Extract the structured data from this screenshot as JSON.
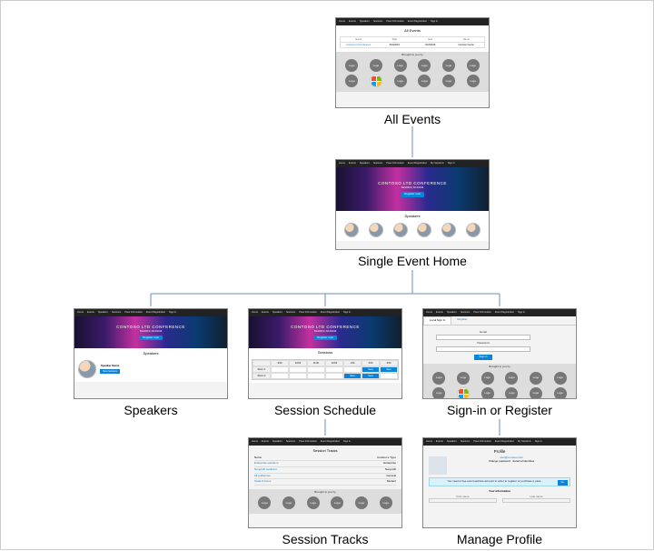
{
  "nav_items": [
    "Home",
    "Events",
    "Speakers",
    "Sessions",
    "Pass Information",
    "Event Registration",
    "My Sessions",
    "Sign In"
  ],
  "conference": {
    "title": "CONTOSO LTD CONFERENCE",
    "dateline": "5/24/2019 | 6/13/2019",
    "cta": "Register now"
  },
  "sections": {
    "speakers_heading": "Speakers",
    "sessions_heading": "Sessions",
    "all_events_heading": "All Events",
    "session_tracks_heading": "Session Tracks",
    "profile_heading": "Profile",
    "sponsors_heading": "Brought to you by"
  },
  "sponsor_label": "Logo",
  "signin": {
    "tab_local": "Local Sign In",
    "tab_register": "Register",
    "email_label": "Email",
    "password_label": "Password",
    "submit": "Sign In"
  },
  "tracks_table": {
    "col_name": "Name",
    "col_audience": "Audience Type",
    "rows": [
      {
        "name": "Enterprise solutions",
        "aud": "Enterprise"
      },
      {
        "name": "Nonprofit solutions",
        "aud": "Nonprofit"
      },
      {
        "name": "All audiences",
        "aud": "General"
      },
      {
        "name": "Student focus",
        "aud": "Student"
      }
    ]
  },
  "profile": {
    "notice": "You need a free event website account in order to register or purchase a pass.",
    "section_info": "Your information"
  },
  "captions": {
    "all_events": "All Events",
    "single_event": "Single Event Home",
    "speakers": "Speakers",
    "schedule": "Session Schedule",
    "signin": "Sign-in or Register",
    "tracks": "Session Tracks",
    "profile": "Manage Profile"
  }
}
